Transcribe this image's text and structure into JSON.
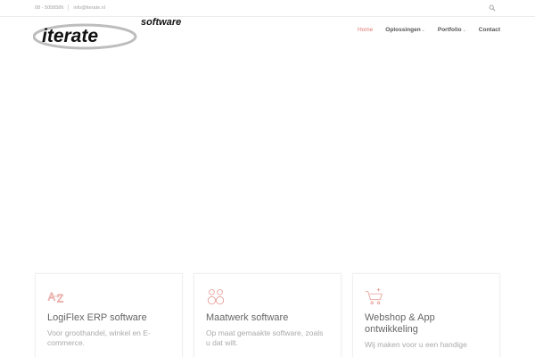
{
  "topbar": {
    "phone": "08 - 5058586",
    "email": "info@iterate.nl",
    "search_icon": "search-icon"
  },
  "logo": {
    "text_main": "iterate",
    "text_sub": "software",
    "colors": {
      "dark": "#111111",
      "accent": "#888888",
      "swoosh": "#bdbdbd"
    }
  },
  "nav": {
    "items": [
      {
        "label": "Home",
        "active": true
      },
      {
        "label": "Oplossingen",
        "dropdown": true
      },
      {
        "label": "Portfolio",
        "dropdown": true
      },
      {
        "label": "Contact"
      }
    ],
    "caret": "⌄",
    "active_color": "#e07a72"
  },
  "cards": [
    {
      "icon": "az-sort-icon",
      "title": "LogiFlex ERP software",
      "text": "Voor groothandel, winkel en E-commerce."
    },
    {
      "icon": "people-icon",
      "title": "Maatwerk software",
      "text": "Op maat gemaakte software, zoals u dat wilt."
    },
    {
      "icon": "cart-icon",
      "title": "Webshop & App ontwikkeling",
      "text": "Wij maken voor u een handige"
    }
  ]
}
